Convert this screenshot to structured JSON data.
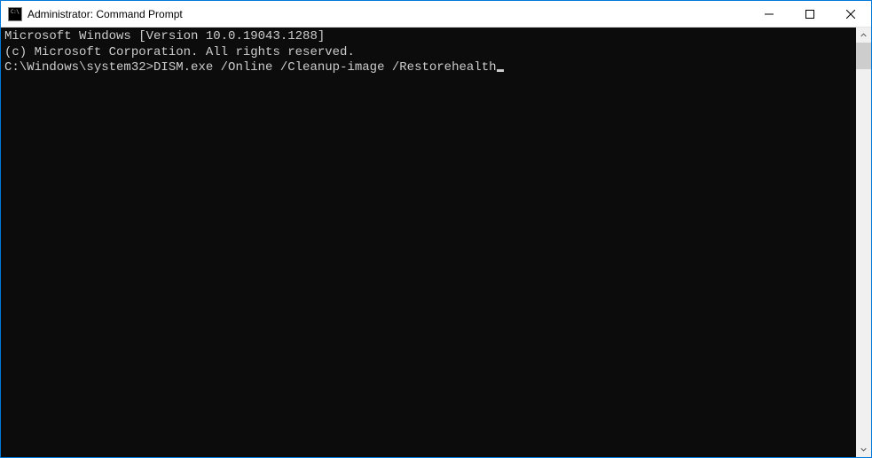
{
  "window": {
    "title": "Administrator: Command Prompt"
  },
  "terminal": {
    "line1": "Microsoft Windows [Version 10.0.19043.1288]",
    "line2": "(c) Microsoft Corporation. All rights reserved.",
    "blank": "",
    "prompt": "C:\\Windows\\system32>",
    "command": "DISM.exe /Online /Cleanup-image /Restorehealth"
  }
}
